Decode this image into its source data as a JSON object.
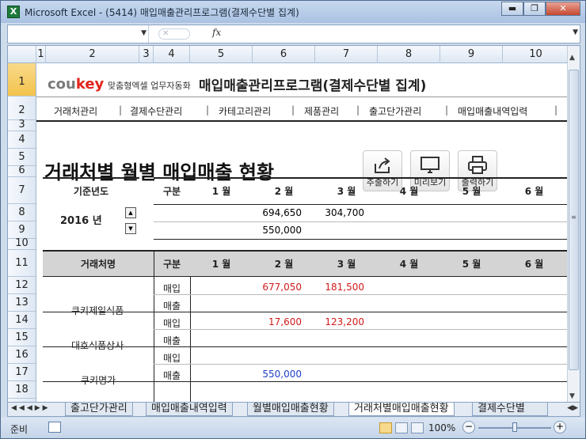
{
  "window": {
    "title": "Microsoft Excel - (5414) 매입매출관리프로그램(결제수단별 집계)",
    "minimize": "▬",
    "restore": "❐",
    "close": "✕"
  },
  "formula_bar": {
    "fx": "fx",
    "cancel": "✕"
  },
  "columns": [
    "1",
    "2",
    "3",
    "4",
    "5",
    "6",
    "7",
    "8",
    "9",
    "10"
  ],
  "rows": [
    "1",
    "2",
    "3",
    "4",
    "5",
    "6",
    "7",
    "8",
    "9",
    "10",
    "11",
    "12",
    "13",
    "14",
    "15",
    "16",
    "17",
    "18"
  ],
  "brand": {
    "logo_main": "cou",
    "logo_accent": "key",
    "logo_sub": "맞춤형엑셀 업무자동화",
    "app_title": "매입매출관리프로그램(결제수단별 집계)"
  },
  "nav": {
    "items": [
      "거래처관리",
      "결제수단관리",
      "카테고리관리",
      "제품관리",
      "출고단가관리",
      "매입매출내역입력"
    ],
    "separator": "|"
  },
  "page_title": "거래처별 월별 매입매출 현황",
  "toolbar": {
    "export": "추출하기",
    "preview": "미리보기",
    "print": "출력하기"
  },
  "summary": {
    "year_label": "기준년도",
    "year_value": "2016 년",
    "header": [
      "구분",
      "1 월",
      "2 월",
      "3 월",
      "4 월",
      "5 월",
      "6 월"
    ],
    "row1": {
      "m2": "694,650",
      "m3": "304,700"
    },
    "row2": {
      "m2": "550,000"
    }
  },
  "detail": {
    "header": [
      "거래처명",
      "구분",
      "1 월",
      "2 월",
      "3 월",
      "4 월",
      "5 월",
      "6 월"
    ],
    "buy_label": "매입",
    "sell_label": "매출",
    "vendors": [
      {
        "name": "쿠키제일식품",
        "buy": {
          "m2": "677,050",
          "m3": "181,500"
        },
        "sell": {}
      },
      {
        "name": "대호식품상사",
        "buy": {
          "m2": "17,600",
          "m3": "123,200"
        },
        "sell": {}
      },
      {
        "name": "쿠키명가",
        "buy": {},
        "sell": {
          "m2": "550,000"
        }
      }
    ]
  },
  "sheet_tabs": [
    "출고단가관리",
    "매입매출내역입력",
    "월별매입매출현황",
    "거래처별매입매출현황",
    "결제수단별"
  ],
  "active_tab": "거래처별매입매출현황",
  "status": {
    "ready": "준비",
    "zoom": "100%",
    "zoom_minus": "−",
    "zoom_plus": "+"
  }
}
